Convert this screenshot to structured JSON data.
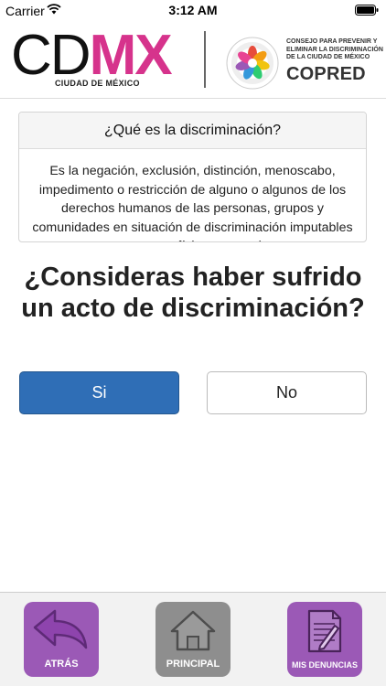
{
  "status_bar": {
    "carrier": "Carrier",
    "time": "3:12 AM"
  },
  "header": {
    "cdmx_cd": "CD",
    "cdmx_mx": "MX",
    "cdmx_subtitle": "CIUDAD DE MÉXICO",
    "copred_description_lines": [
      "CONSEJO PARA PREVENIR Y",
      "ELIMINAR LA DISCRIMINACIÓN",
      "DE LA CIUDAD DE MÉXICO"
    ],
    "copred_name": "COPRED",
    "accent_color": "#d6338c"
  },
  "info_card": {
    "title": "¿Qué es la discriminación?",
    "body": "Es la negación, exclusión, distinción, menoscabo, impedimento o restricción de alguno o algunos de los derechos humanos de las personas, grupos y comunidades en situación de discriminación imputables a personas físicas o morales"
  },
  "question": {
    "text": "¿Consideras haber sufrido un acto de discriminación?"
  },
  "answers": {
    "yes_label": "Si",
    "no_label": "No",
    "primary_color": "#2f6eb6"
  },
  "bottom_nav": {
    "items": [
      {
        "label": "ATRÁS",
        "icon": "back-arrow-icon",
        "color": "#9b59b6"
      },
      {
        "label": "PRINCIPAL",
        "icon": "home-icon",
        "color": "#8e8e8e"
      },
      {
        "label": "MIS DENUNCIAS",
        "icon": "document-pen-icon",
        "color": "#9b59b6"
      }
    ]
  }
}
